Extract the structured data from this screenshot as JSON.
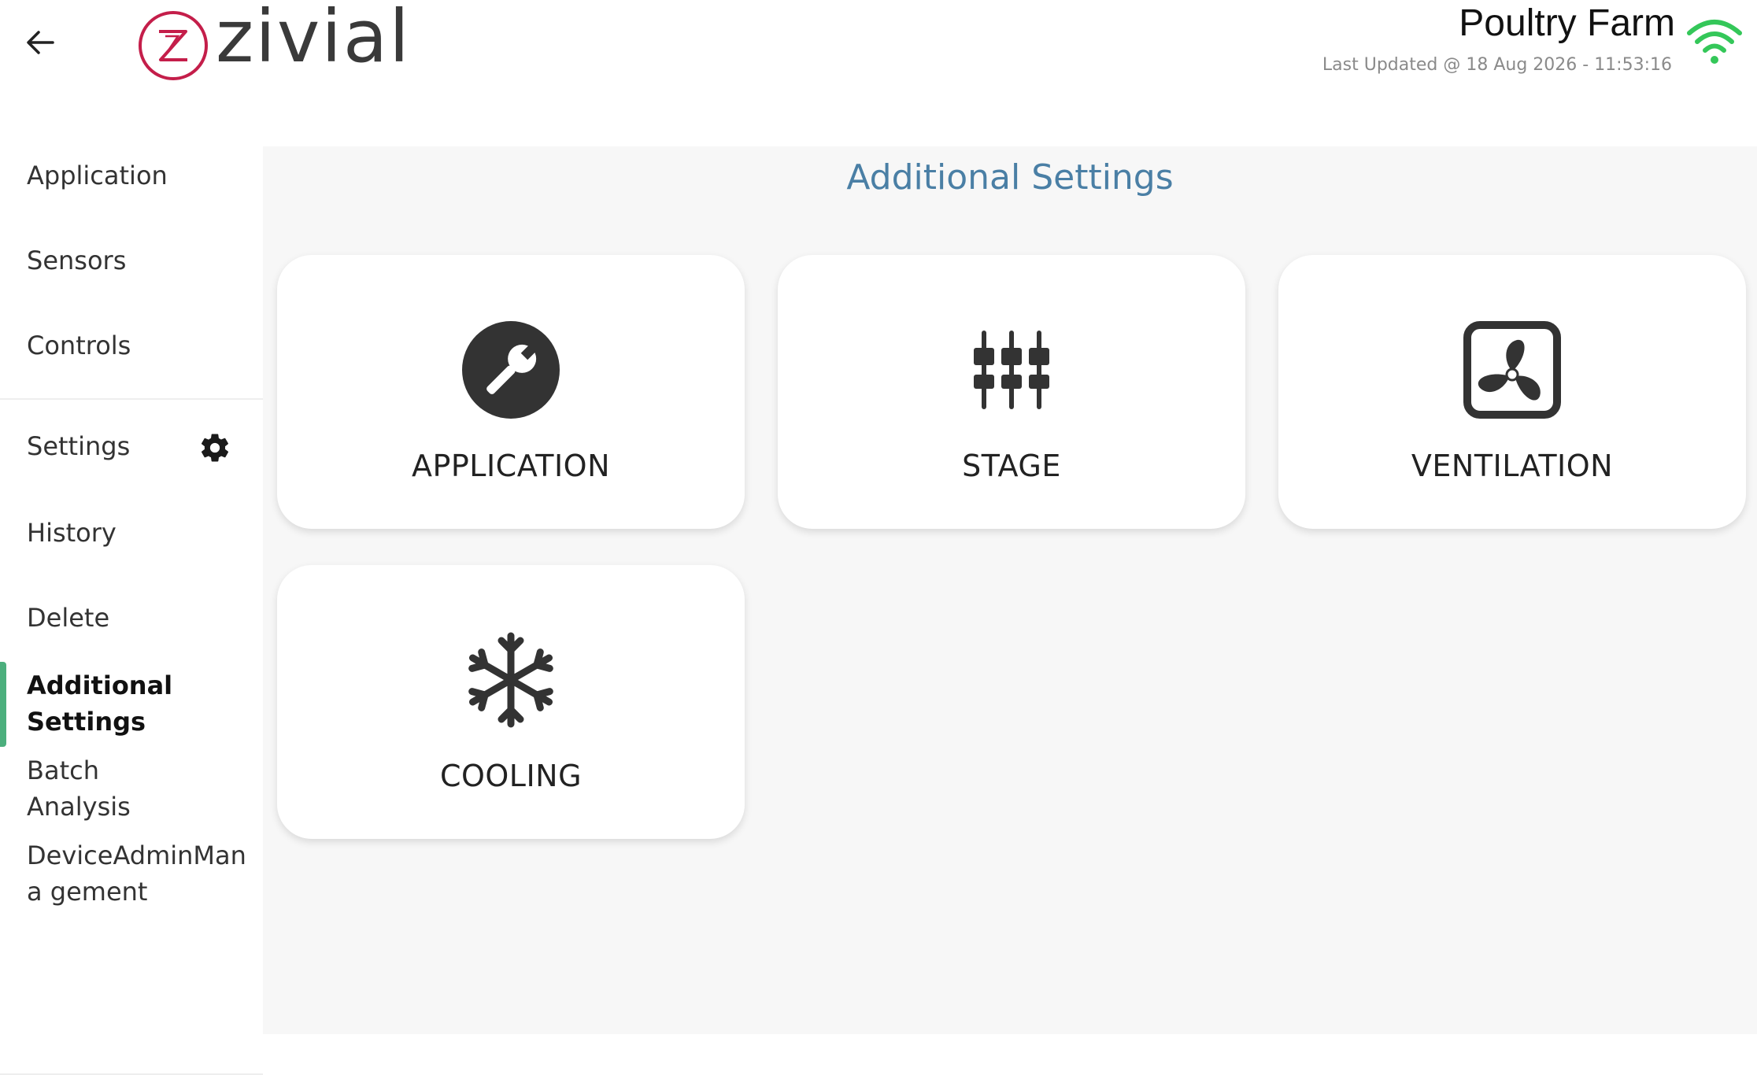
{
  "header": {
    "brand": "zivial",
    "farm_title": "Poultry Farm",
    "last_updated": "Last Updated @ 18 Aug 2026 - 11:53:16"
  },
  "sidebar": {
    "items": [
      {
        "label": "Application"
      },
      {
        "label": "Sensors"
      },
      {
        "label": "Controls"
      },
      {
        "label": "Settings"
      },
      {
        "label": "History"
      },
      {
        "label": "Delete"
      },
      {
        "label": "Additional Settings"
      },
      {
        "label": "Batch Analysis"
      },
      {
        "label": "DeviceAdminMana gement"
      }
    ],
    "active_index": 6
  },
  "main": {
    "title": "Additional Settings",
    "cards": [
      {
        "label": "APPLICATION",
        "icon": "wrench-icon"
      },
      {
        "label": "STAGE",
        "icon": "sliders-icon"
      },
      {
        "label": "VENTILATION",
        "icon": "fan-icon"
      },
      {
        "label": "COOLING",
        "icon": "snowflake-icon"
      }
    ]
  },
  "colors": {
    "accent_title": "#4a7fa5",
    "active_marker": "#4caf7d",
    "wifi": "#34c759",
    "logo_red": "#c41e4a",
    "icon_dark": "#333333"
  }
}
